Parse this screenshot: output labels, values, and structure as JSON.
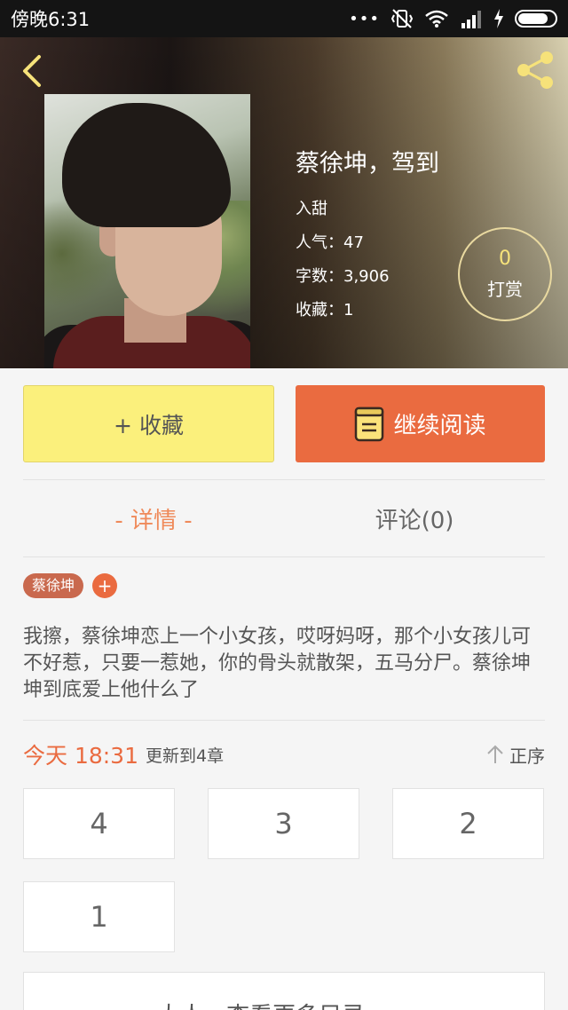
{
  "status_bar": {
    "time": "傍晚6:31"
  },
  "book": {
    "title": "蔡徐坤，驾到",
    "genre": "入甜",
    "popularity_label": "人气：",
    "popularity": "47",
    "word_count_label": "字数：",
    "word_count": "3,906",
    "favorites_label": "收藏：",
    "favorites": "1"
  },
  "reward": {
    "count": "0",
    "label": "打赏"
  },
  "actions": {
    "collect_label": "+ 收藏",
    "read_label": "继续阅读"
  },
  "tabs": [
    {
      "label": "- 详情 -",
      "active": true
    },
    {
      "label": "评论(0)",
      "active": false
    }
  ],
  "tags": [
    "蔡徐坤"
  ],
  "tag_add": "+",
  "description": "我擦，蔡徐坤恋上一个小女孩，哎呀妈呀，那个小女孩儿可不好惹，只要一惹她，你的骨头就散架，五马分尸。蔡徐坤坤到底爱上他什么了",
  "update": {
    "time": "今天 18:31",
    "text": "更新到4章",
    "sort_label": "正序"
  },
  "chapters": [
    "4",
    "3",
    "2",
    "1"
  ],
  "more_label": "大人，查看更多目录 >>",
  "colors": {
    "accent": "#ea6b40",
    "collect_bg": "#fbf07c",
    "tab_active": "#ef8a5a"
  }
}
